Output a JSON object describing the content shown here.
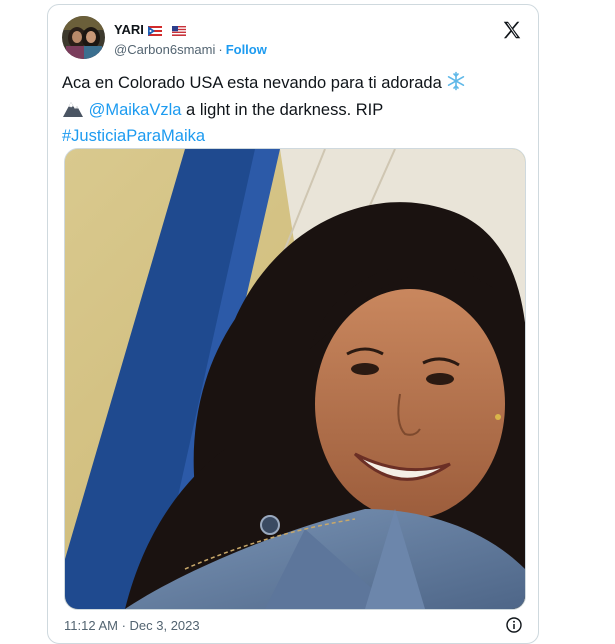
{
  "tweet": {
    "display_name": "YARI",
    "flags": [
      "puerto-rico-flag",
      "us-flag"
    ],
    "handle": "@Carbon6smami",
    "separator": "·",
    "follow_label": "Follow",
    "text": {
      "line1": "Aca en Colorado USA  esta nevando para ti adorada",
      "line2_mention": "@MaikaVzla",
      "line2_rest": " a light in the darkness. RIP",
      "hashtag": "#JusticiaParaMaika"
    },
    "icons": {
      "platform": "x-logo-icon",
      "snowflake": "snowflake-icon",
      "mountain": "snow-capped-mountain-icon",
      "info": "info-icon"
    },
    "timestamp": "11:12 AM · Dec 3, 2023"
  },
  "colors": {
    "link": "#1d9bf0",
    "text": "#0f1419",
    "muted": "#536471",
    "border": "#cfd9de"
  }
}
